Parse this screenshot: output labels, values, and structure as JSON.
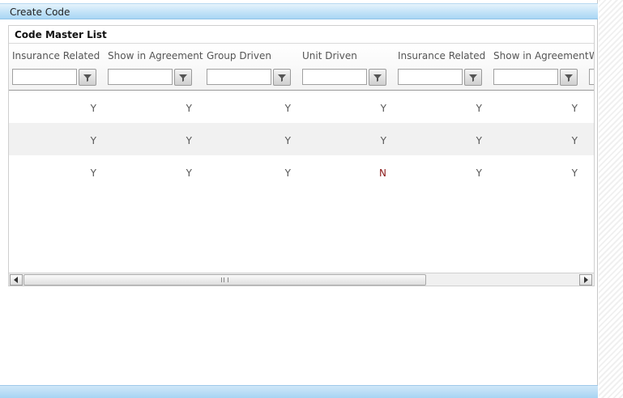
{
  "panel": {
    "title": "Create Code"
  },
  "grid": {
    "title": "Code Master List",
    "columns": [
      {
        "label": "Insurance Related"
      },
      {
        "label": "Show in Agreement"
      },
      {
        "label": "Group Driven"
      },
      {
        "label": "Unit Driven"
      },
      {
        "label": "Insurance Related"
      },
      {
        "label": "Show in Agreement"
      },
      {
        "label": "W"
      }
    ],
    "rows": [
      [
        "Y",
        "Y",
        "Y",
        "Y",
        "Y",
        "Y"
      ],
      [
        "Y",
        "Y",
        "Y",
        "Y",
        "Y",
        "Y"
      ],
      [
        "Y",
        "Y",
        "Y",
        "N",
        "Y",
        "Y"
      ]
    ]
  },
  "icons": {
    "filter": "funnel-filter-icon",
    "scroll_left": "arrow-left-icon",
    "scroll_right": "arrow-right-icon"
  },
  "colors": {
    "header_blue": "#a9d6f4",
    "n_value": "#8b1a1a"
  }
}
